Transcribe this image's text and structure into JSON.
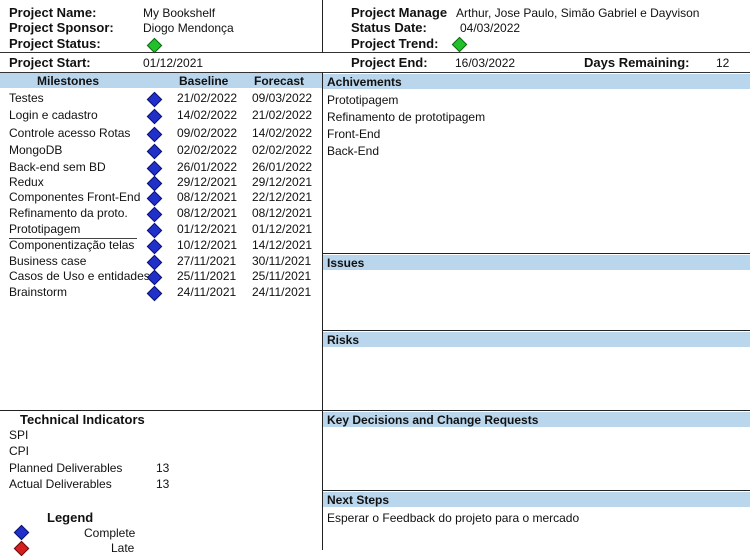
{
  "header": {
    "project_name_label": "Project Name:",
    "project_name": "My Bookshelf",
    "project_sponsor_label": "Project Sponsor:",
    "project_sponsor": "Diogo Mendonça",
    "project_status_label": "Project Status:",
    "project_start_label": "Project Start:",
    "project_start": "01/12/2021",
    "project_manager_label": "Project Manage",
    "project_manager": "Arthur, Jose Paulo, Simão  Gabriel e Dayvison",
    "status_date_label": "Status Date:",
    "status_date": "04/03/2022",
    "project_trend_label": "Project Trend:",
    "project_end_label": "Project End:",
    "project_end": "16/03/2022",
    "days_remaining_label": "Days Remaining:",
    "days_remaining": "12",
    "status_color": "#22c02a",
    "trend_color": "#22c02a"
  },
  "milestones": {
    "header_name": "Milestones",
    "header_baseline": "Baseline",
    "header_forecast": "Forecast",
    "rows": [
      {
        "name": "Testes",
        "baseline": "21/02/2022",
        "forecast": "09/03/2022"
      },
      {
        "name": "Login e cadastro",
        "baseline": "14/02/2022",
        "forecast": "21/02/2022"
      },
      {
        "name": "Controle acesso Rotas",
        "baseline": "09/02/2022",
        "forecast": "14/02/2022"
      },
      {
        "name": "MongoDB",
        "baseline": "02/02/2022",
        "forecast": "02/02/2022"
      },
      {
        "name": "Back-end sem BD",
        "baseline": "26/01/2022",
        "forecast": "26/01/2022"
      },
      {
        "name": "Redux",
        "baseline": "29/12/2021",
        "forecast": "29/12/2021"
      },
      {
        "name": "Componentes Front-End",
        "baseline": "08/12/2021",
        "forecast": "22/12/2021"
      },
      {
        "name": "Refinamento da proto.",
        "baseline": "08/12/2021",
        "forecast": "08/12/2021"
      },
      {
        "name": "Prototipagem",
        "baseline": "01/12/2021",
        "forecast": "01/12/2021"
      },
      {
        "name": "Componentização telas",
        "baseline": "10/12/2021",
        "forecast": "14/12/2021"
      },
      {
        "name": "Business case",
        "baseline": "27/11/2021",
        "forecast": "30/11/2021"
      },
      {
        "name": "Casos de Uso e entidades",
        "baseline": "25/11/2021",
        "forecast": "25/11/2021"
      },
      {
        "name": "Brainstorm",
        "baseline": "24/11/2021",
        "forecast": "24/11/2021"
      }
    ]
  },
  "achievements": {
    "title": "Achivements",
    "items": [
      "Prototipagem",
      "Refinamento de prototipagem",
      "Front-End",
      "Back-End"
    ]
  },
  "issues": {
    "title": "Issues"
  },
  "risks": {
    "title": "Risks"
  },
  "decisions": {
    "title": "Key Decisions and Change Requests"
  },
  "next_steps": {
    "title": "Next Steps",
    "items": [
      "Esperar o Feedback do projeto para o mercado"
    ]
  },
  "technical_indicators": {
    "title": "Technical Indicators",
    "spi_label": "SPI",
    "cpi_label": "CPI",
    "planned_label": "Planned Deliverables",
    "planned_value": "13",
    "actual_label": "Actual Deliverables",
    "actual_value": "13"
  },
  "legend": {
    "title": "Legend",
    "complete_label": "Complete",
    "late_label": "Late",
    "complete_color": "#2130c8",
    "late_color": "#d42020"
  }
}
